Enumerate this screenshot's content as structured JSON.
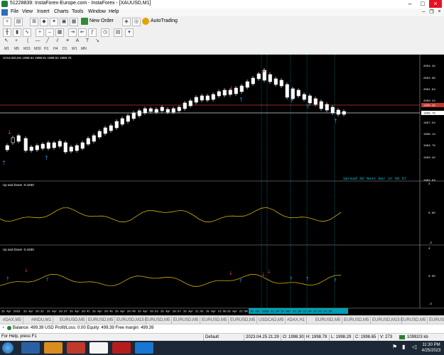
{
  "window": {
    "title": "51228839: InstaForex-Europe.com - InstaForex - [XAUUSD,M1]"
  },
  "menu": [
    "File",
    "View",
    "Insert",
    "Charts",
    "Tools",
    "Window",
    "Help"
  ],
  "toolbar": {
    "new_order": "New Order",
    "autotrading": "AutoTrading"
  },
  "timeframes": [
    "M1",
    "M5",
    "M15",
    "M30",
    "H1",
    "H4",
    "D1",
    "W1",
    "MN"
  ],
  "main_chart": {
    "label": "XAUUSD,M1  1998.64 1998.81 1998.52 1998.70",
    "price_ticks": [
      "2004.34",
      "2002.99",
      "2001.64",
      "2000.24",
      "1998.70",
      "1997.54",
      "1996.14",
      "1994.79",
      "1993.44",
      "1992.04"
    ],
    "current_price_tag": "1998.70",
    "red_tag": "1999.30",
    "spread_info": "Spread  80  Next Bar in 00 57",
    "colors": {
      "bull": "#ffffff",
      "bear": "#ffffff",
      "grid": "#2e6e2e",
      "accent": "#00bcd4"
    }
  },
  "indicator1": {
    "label": "Up and Down -0.1830",
    "ticks": [
      "3",
      "0.00",
      "-3"
    ]
  },
  "indicator2": {
    "label": "Up and Down -0.1830",
    "ticks": [
      "3",
      "0.00",
      "-3"
    ]
  },
  "time_axis": [
    "25 Apr 2023",
    "25 Apr 20:32",
    "25 Apr 20:37",
    "25 Apr 20:41",
    "25 Apr 20:45",
    "25 Apr 20:49",
    "25 Apr 20:53",
    "25 Apr 20:57",
    "25 Apr 21:01",
    "25 Apr 21:05",
    "25 Apr 21:09"
  ],
  "time_highlight": "25 Apr 2023 21:29  25 Apr 21:26 21:24 21:26 21:29",
  "symbol_tabs": [
    "#DAX,M5",
    "#INDU,M1",
    "EURUSD,M5",
    "EURUSD,M5",
    "EURUSD,M15",
    "EURUSD,M5",
    "EURUSD,M5",
    "EURUSD,M5",
    "EURUSD,M5",
    "USDCAD,M5",
    "#DAX,H1",
    "EURUSD,M5",
    "EURUSD,M5",
    "EURUSD,M15",
    "EURUSD,M5",
    "EURUSD,M5"
  ],
  "balance_bar": "Balance: 499.39 USD  Profit/Loss: 0.00  Equity: 499.39  Free margin: 499.39",
  "status": {
    "help": "For Help, press F1",
    "profile": "Default",
    "datetime": "2023.04.25 21:29",
    "open": "O: 1998.30",
    "high": "H: 1998.79",
    "low": "L: 1998.29",
    "close": "C: 1998.65",
    "volume": "V: 273",
    "traffic": "10992/3 kb"
  },
  "clock": {
    "time": "11:30 PM",
    "date": "4/25/2023"
  }
}
